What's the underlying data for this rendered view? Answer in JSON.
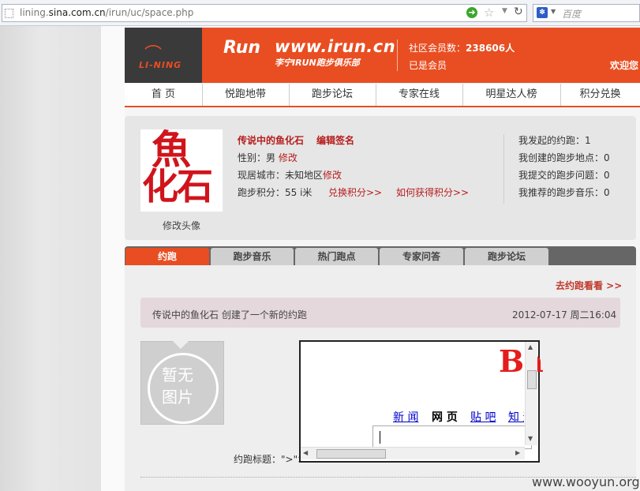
{
  "browser": {
    "url_prefix": "lining.",
    "url_domain": "sina.com.cn",
    "url_path": "/irun/uc/space.php",
    "search_placeholder": "百度"
  },
  "header": {
    "lining_text": "LI-NING",
    "irun_run": "Run",
    "irun_url": "www.irun.cn",
    "irun_sub": "李宁IRUN跑步俱乐部",
    "member_label": "社区会员数：",
    "member_count": "238606人",
    "already_member": "已是会员",
    "welcome": "欢迎您"
  },
  "nav": [
    "首 页",
    "悦跑地带",
    "跑步论坛",
    "专家在线",
    "明星达人榜",
    "积分兑换"
  ],
  "profile": {
    "avatar_line1": "魚",
    "avatar_line2": "化石",
    "edit_avatar": "修改头像",
    "name": "传说中的鱼化石",
    "edit_sign": "编辑签名",
    "gender_label": "性别：男",
    "gender_edit": "修改",
    "city_label": "现居城市：未知地区",
    "city_edit": "修改",
    "score_label": "跑步积分：55 i米",
    "exchange": "兑换积分>>",
    "how_get": "如何获得积分>>",
    "stats": [
      "我发起的约跑：1",
      "我创建的跑步地点：0",
      "我提交的跑步问题：0",
      "我推荐的跑步音乐：0"
    ]
  },
  "tabs": [
    "约跑",
    "跑步音乐",
    "热门跑点",
    "专家问答",
    "跑步论坛"
  ],
  "content": {
    "go_meet": "去约跑看看 >>",
    "activity_text": "传说中的鱼化石 创建了一个新的约跑",
    "activity_time": "2012-07-17 周二16:04",
    "noimg_line1": "暂无",
    "noimg_line2": "图片",
    "title_label": "约跑标题：\">\">"
  },
  "iframe": {
    "logo": "Ba",
    "links": [
      "新 闻",
      "网 页",
      "贴 吧",
      "知 道"
    ]
  },
  "watermark": "www.wooyun.org"
}
